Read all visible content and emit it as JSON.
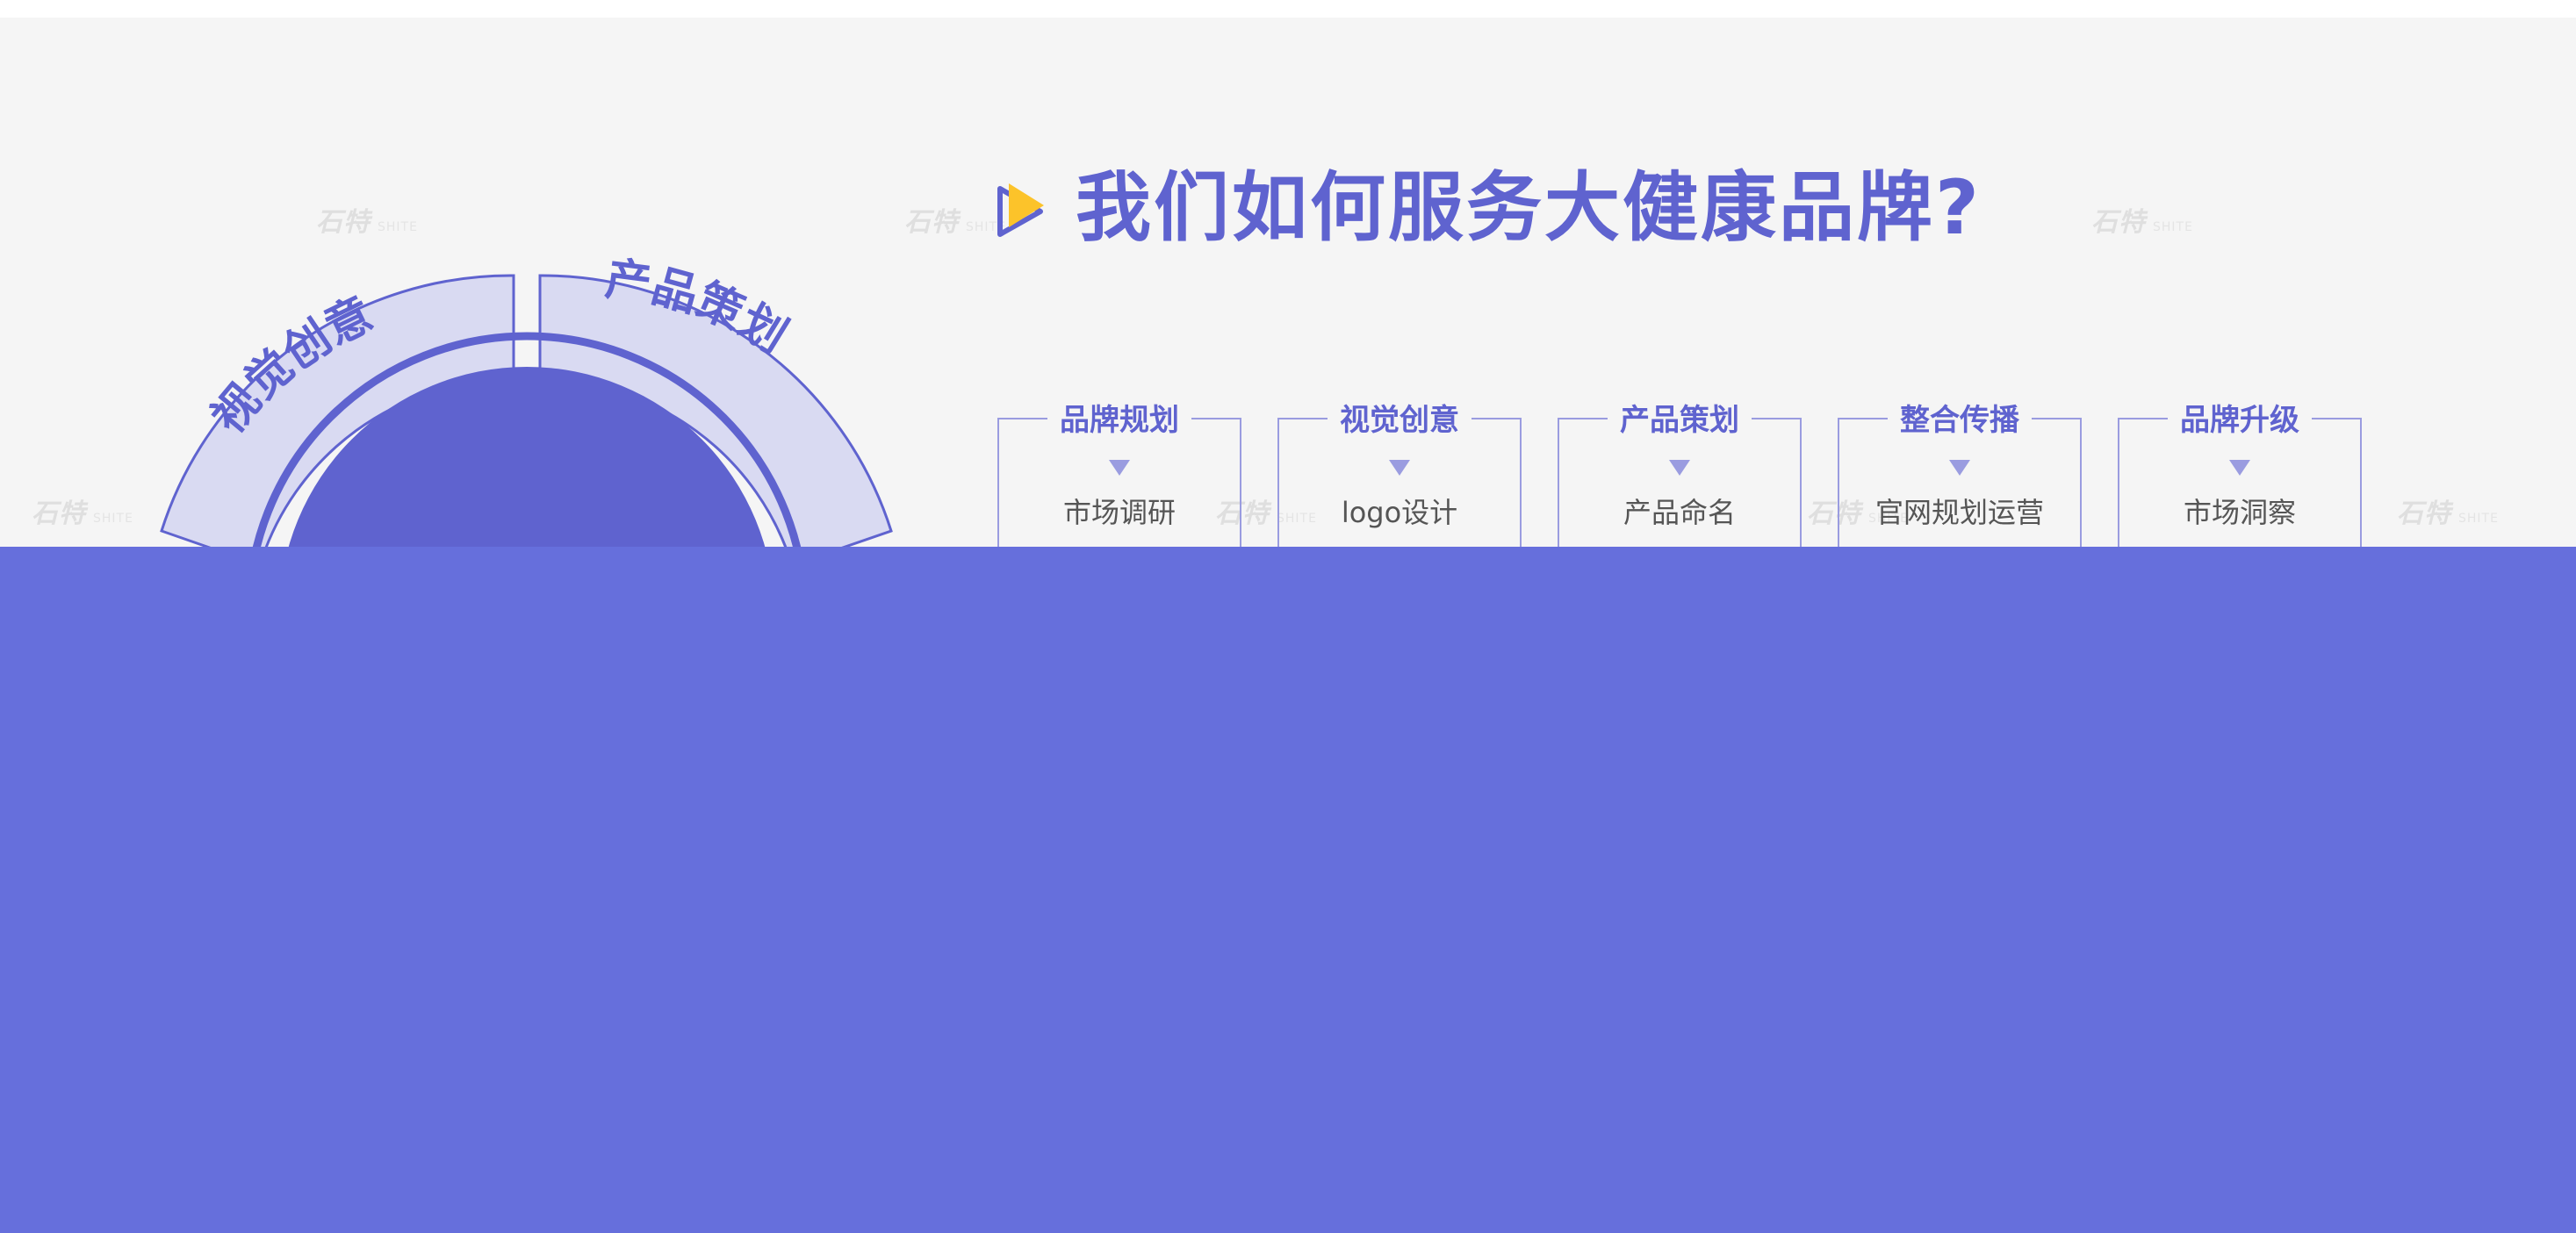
{
  "header": {
    "title": "我们如何服务大健康品牌?"
  },
  "watermark": {
    "text": "石特"
  },
  "wheel": {
    "segments": [
      {
        "label": "视觉创意"
      },
      {
        "label": "产品策划"
      }
    ]
  },
  "columns": [
    {
      "label": "品牌规划",
      "item": "市场调研"
    },
    {
      "label": "视觉创意",
      "item": "logo设计"
    },
    {
      "label": "产品策划",
      "item": "产品命名"
    },
    {
      "label": "整合传播",
      "item": "官网规划运营"
    },
    {
      "label": "品牌升级",
      "item": "市场洞察"
    }
  ],
  "colors": {
    "accent": "#5f63cf",
    "segment_fill": "#d9daf2",
    "overlay": "#666fdc",
    "play_icon": "#fcc32a",
    "background": "#f5f5f5"
  }
}
